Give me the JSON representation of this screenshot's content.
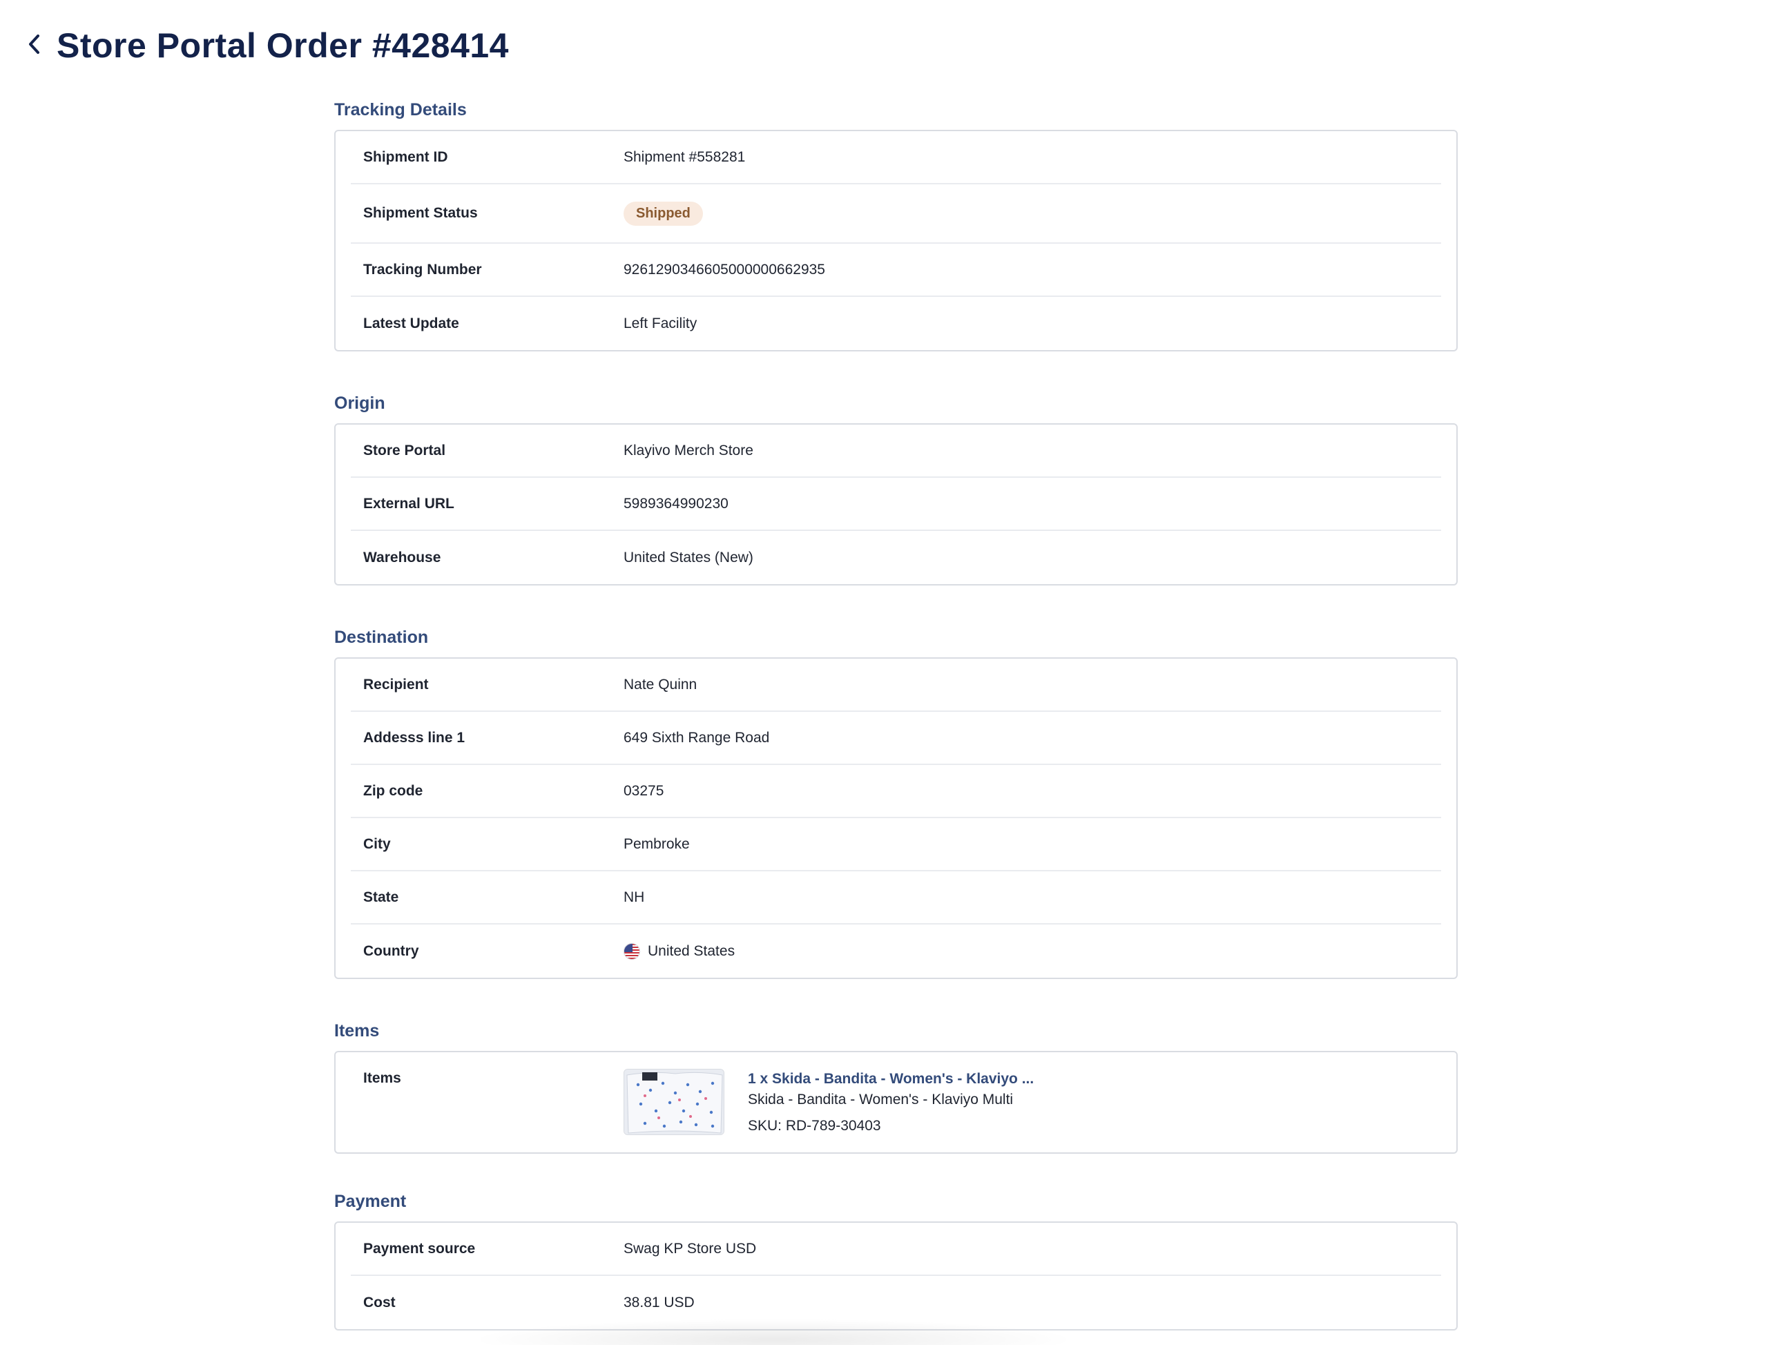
{
  "header": {
    "title": "Store Portal Order #428414",
    "back_icon": "chevron-left-icon"
  },
  "tracking": {
    "title": "Tracking Details",
    "shipment_id_label": "Shipment ID",
    "shipment_id": "Shipment #558281",
    "status_label": "Shipment Status",
    "status": "Shipped",
    "tracking_label": "Tracking Number",
    "tracking_number": "9261290346605000000662935",
    "update_label": "Latest Update",
    "latest_update": "Left Facility"
  },
  "origin": {
    "title": "Origin",
    "store_label": "Store Portal",
    "store": "Klayivo Merch Store",
    "url_label": "External URL",
    "external_url": "5989364990230",
    "warehouse_label": "Warehouse",
    "warehouse": "United States (New)"
  },
  "destination": {
    "title": "Destination",
    "recipient_label": "Recipient",
    "recipient": "Nate Quinn",
    "address_label": "Addesss line 1",
    "address": "649 Sixth Range Road",
    "zip_label": "Zip code",
    "zip": "03275",
    "city_label": "City",
    "city": "Pembroke",
    "state_label": "State",
    "state": "NH",
    "country_label": "Country",
    "country": "United States",
    "country_flag_icon": "us-flag-icon"
  },
  "items": {
    "title": "Items",
    "label": "Items",
    "item_title": "1 x Skida - Bandita - Women's - Klaviyo ...",
    "item_subtitle": "Skida - Bandita - Women's - Klaviyo Multi",
    "item_sku": "SKU: RD-789-30403"
  },
  "payment": {
    "title": "Payment",
    "source_label": "Payment source",
    "source": "Swag KP Store USD",
    "cost_label": "Cost",
    "cost": "38.81 USD"
  },
  "colors": {
    "title": "#13224a",
    "section_title": "#334b7a",
    "link": "#2f64d6",
    "badge_bg": "#f9eadf",
    "badge_text": "#8a5a30"
  }
}
